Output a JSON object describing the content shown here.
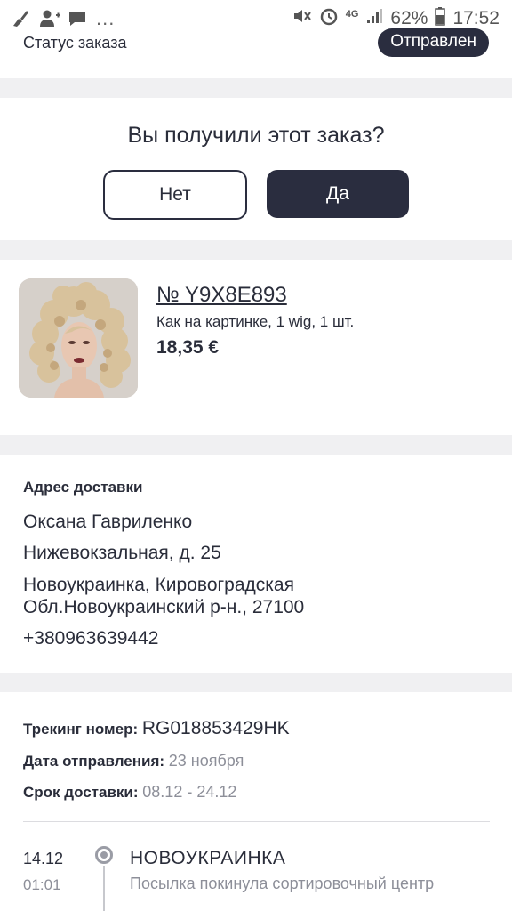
{
  "statusbar": {
    "icons_left": [
      "broom-icon",
      "add-user-icon",
      "chat-icon"
    ],
    "more": "...",
    "network": "4G",
    "battery": "62%",
    "time": "17:52"
  },
  "order_status": {
    "label": "Статус заказа",
    "badge": "Отправлен"
  },
  "confirm": {
    "question": "Вы получили этот заказ?",
    "no_label": "Нет",
    "yes_label": "Да"
  },
  "product": {
    "order_number": "№ Y9X8E893",
    "description": "Как на картинке, 1 wig, 1 шт.",
    "price": "18,35 €",
    "image_icon": "wig-photo"
  },
  "address": {
    "title": "Адрес доставки",
    "name": "Оксана Гавриленко",
    "street": "Нижевокзальная, д. 25",
    "city_line1": "Новоукраинка, Кировоградская",
    "city_line2": "Обл.Новоукраинский р-н., 27100",
    "phone": "+380963639442"
  },
  "tracking": {
    "number_label": "Трекинг номер:",
    "number_value": "RG018853429HK",
    "ship_date_label": "Дата отправления:",
    "ship_date_value": "23 ноября",
    "delivery_label": "Срок доставки:",
    "delivery_value": "08.12 - 24.12"
  },
  "timeline": [
    {
      "date": "14.12",
      "time": "01:01",
      "city": "НОВОУКРАИНКА",
      "message": "Посылка покинула сортировочный центр"
    }
  ],
  "colors": {
    "primary": "#2a2d3f",
    "gap": "#f0f0f2",
    "muted": "#8d8f99"
  }
}
